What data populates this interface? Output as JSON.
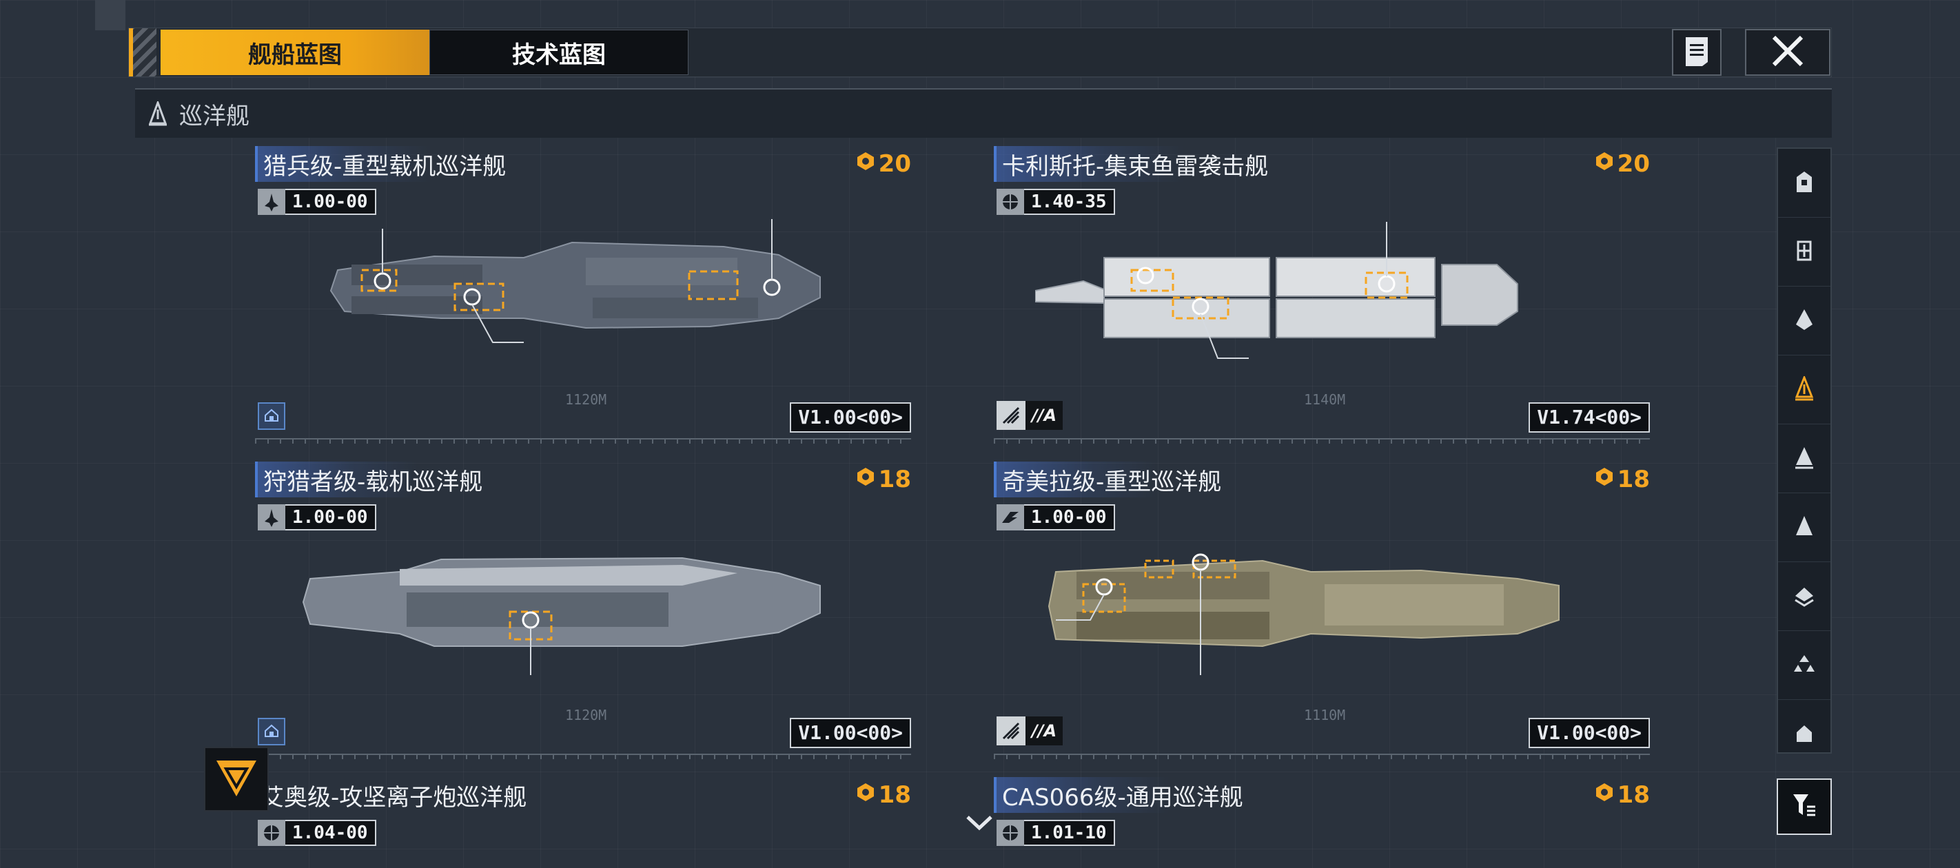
{
  "tabs": [
    {
      "label": "舰船蓝图",
      "active": true
    },
    {
      "label": "技术蓝图",
      "active": false
    }
  ],
  "toolbar": {
    "notes_icon": "notes-icon",
    "close_icon": "close-icon"
  },
  "section": {
    "title": "巡洋舰",
    "icon": "cruiser-icon"
  },
  "cards": [
    {
      "title": "猎兵级-重型载机巡洋舰",
      "points": "20",
      "version": "1.00-00",
      "card_version": "V1.00<00>",
      "length": "1120M",
      "badge": "role",
      "class_label": ""
    },
    {
      "title": "卡利斯托-集束鱼雷袭击舰",
      "points": "20",
      "version": "1.40-35",
      "card_version": "V1.74<00>",
      "length": "1140M",
      "badge": "class",
      "class_label": "//A"
    },
    {
      "title": "狩猎者级-载机巡洋舰",
      "points": "18",
      "version": "1.00-00",
      "card_version": "V1.00<00>",
      "length": "1120M",
      "badge": "role",
      "class_label": ""
    },
    {
      "title": "奇美拉级-重型巡洋舰",
      "points": "18",
      "version": "1.00-00",
      "card_version": "V1.00<00>",
      "length": "1110M",
      "badge": "class",
      "class_label": "//A"
    },
    {
      "title": "艾奥级-攻坚离子炮巡洋舰",
      "points": "18",
      "version": "1.04-00"
    },
    {
      "title": "CAS066级-通用巡洋舰",
      "points": "18",
      "version": "1.01-10"
    }
  ],
  "side_toolbar": {
    "items": [
      "carrier-icon",
      "frigate-icon",
      "destroyer-icon",
      "cruiser-icon",
      "battlecruiser-icon",
      "battleship-icon",
      "auxiliary-icon",
      "fighter-icon",
      "corvette-icon"
    ],
    "active_index": 3
  },
  "colors": {
    "accent": "#f5a623",
    "card_blue": "#4a7ad0",
    "background": "#2a323d"
  }
}
